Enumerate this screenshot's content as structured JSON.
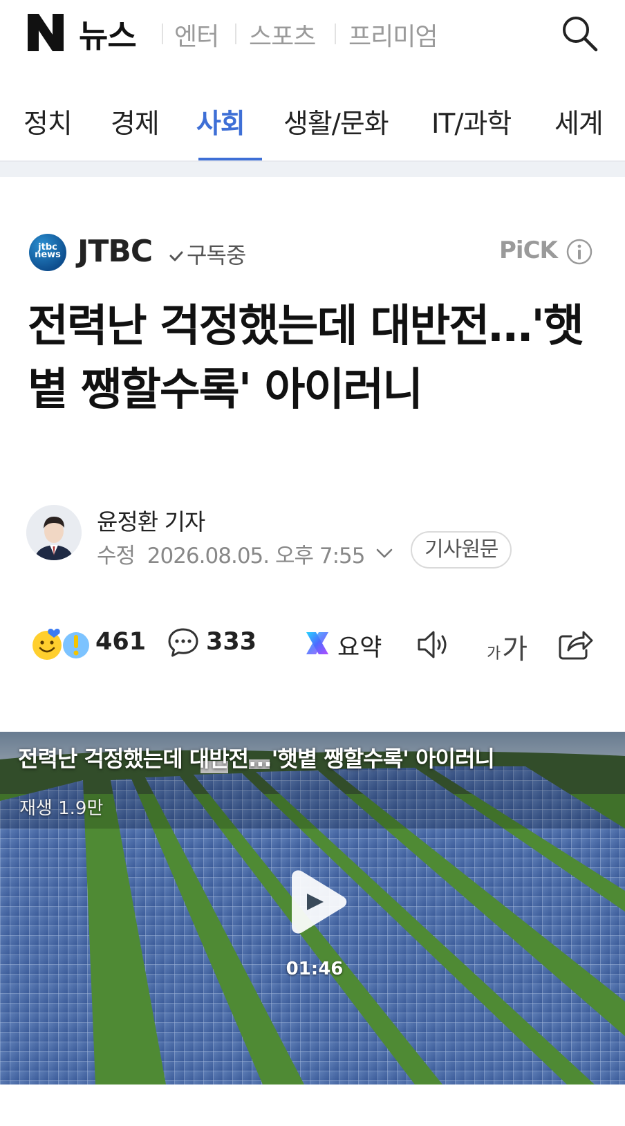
{
  "header": {
    "brand": "뉴스",
    "nav": [
      "엔터",
      "스포츠",
      "프리미엄"
    ]
  },
  "categories": {
    "items": [
      "정치",
      "경제",
      "사회",
      "생활/문화",
      "IT/과학",
      "세계"
    ],
    "active": "사회"
  },
  "press": {
    "name": "JTBC",
    "logo_text": "jtbc news",
    "subscribe_label": "구독중",
    "pick_label": "PiCK"
  },
  "article": {
    "headline": "전력난 걱정했는데 대반전…'햇볕 쨍할수록' 아이러니",
    "reporter": "윤정환 기자",
    "modified_label": "수정",
    "modified_datetime": "2026.08.05. 오후 7:55",
    "original_button": "기사원문"
  },
  "actions": {
    "reaction_count": "461",
    "comment_count": "333",
    "summary_label": "요약",
    "font_small": "가",
    "font_large": "가"
  },
  "video": {
    "title": "전력난 걱정했는데 대반전...'햇볕 쨍할수록' 아이러니",
    "plays": "재생 1.9만",
    "duration": "01:46"
  },
  "colors": {
    "accent": "#3e6fd6",
    "press_logo": "#0d4c8c"
  }
}
